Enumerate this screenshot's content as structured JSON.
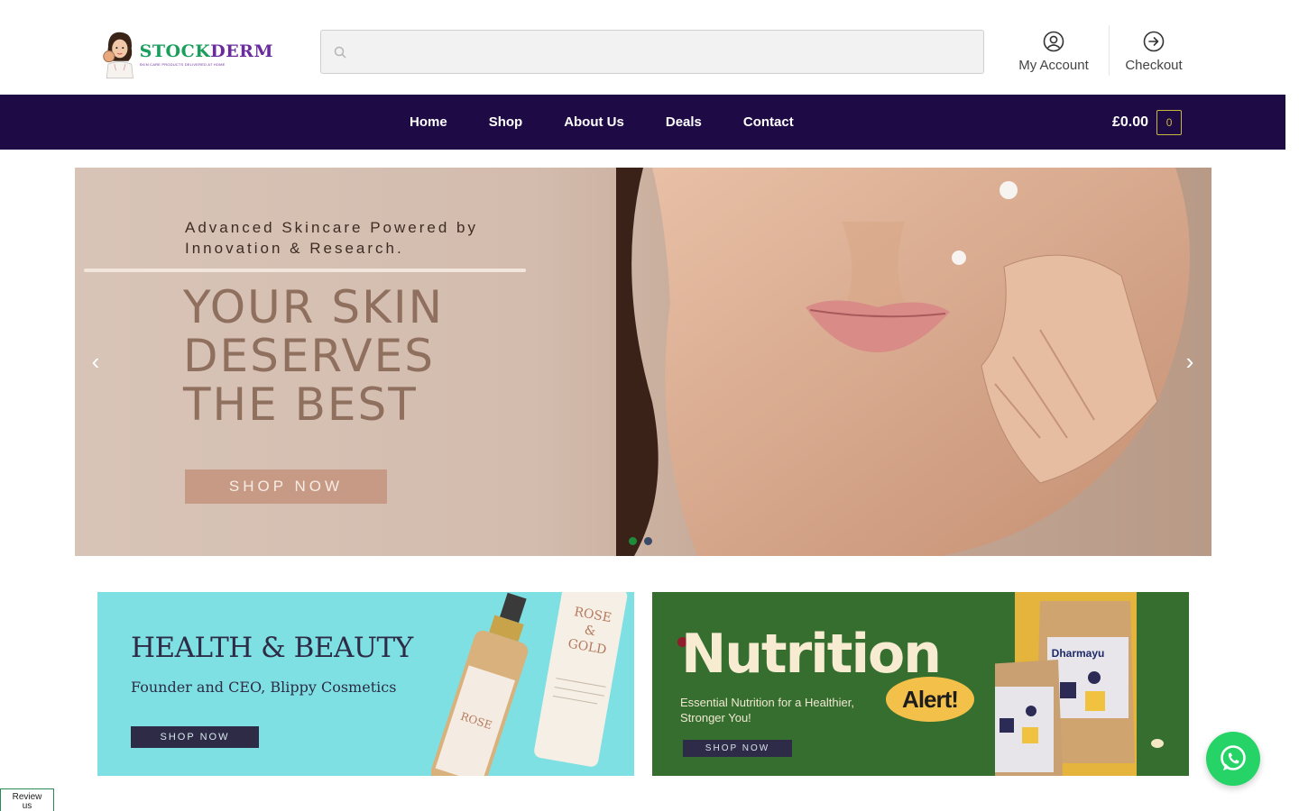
{
  "header": {
    "logo": {
      "word_part1": "STOCK",
      "word_part2": "DERM",
      "tagline": "SKIN CARE PRODUCTS DELIVERED AT HOME"
    },
    "search": {
      "value": "",
      "placeholder": ""
    },
    "account_label": "My Account",
    "checkout_label": "Checkout"
  },
  "nav": {
    "items": [
      {
        "label": "Home"
      },
      {
        "label": "Shop"
      },
      {
        "label": "About Us"
      },
      {
        "label": "Deals"
      },
      {
        "label": "Contact"
      }
    ],
    "cart_total": "£0.00",
    "cart_count": "0"
  },
  "hero": {
    "subtitle_line1": "Advanced Skincare Powered by",
    "subtitle_line2": "Innovation & Research.",
    "title_line1": "YOUR SKIN",
    "title_line2": "DESERVES",
    "title_line3": "THE BEST",
    "button": "SHOP NOW",
    "prev_icon": "‹",
    "next_icon": "›",
    "dot_colors": [
      "#1e8a3a",
      "#3c4a6a"
    ]
  },
  "banners": {
    "health": {
      "title": "HEALTH & BEAUTY",
      "subtitle": "Founder and CEO, Blippy Cosmetics",
      "button": "SHOP NOW",
      "bottle_label_1": "ROSE & GOLD",
      "bottle_label_2": "ROSE & GOLD"
    },
    "nutrition": {
      "title": "Nutrition",
      "alert": "Alert!",
      "subtitle_line1": "Essential Nutrition for a Healthier,",
      "subtitle_line2": "Stronger You!",
      "button": "SHOP NOW",
      "brand": "Dharmayu"
    }
  },
  "floating": {
    "review_line1": "Review",
    "review_line2": "us"
  },
  "colors": {
    "nav_bg": "#1e0a45",
    "cart_badge": "#c8b740",
    "whatsapp": "#25d366",
    "health_bg": "#7ee0e3",
    "nutrition_bg": "#366e2f"
  }
}
